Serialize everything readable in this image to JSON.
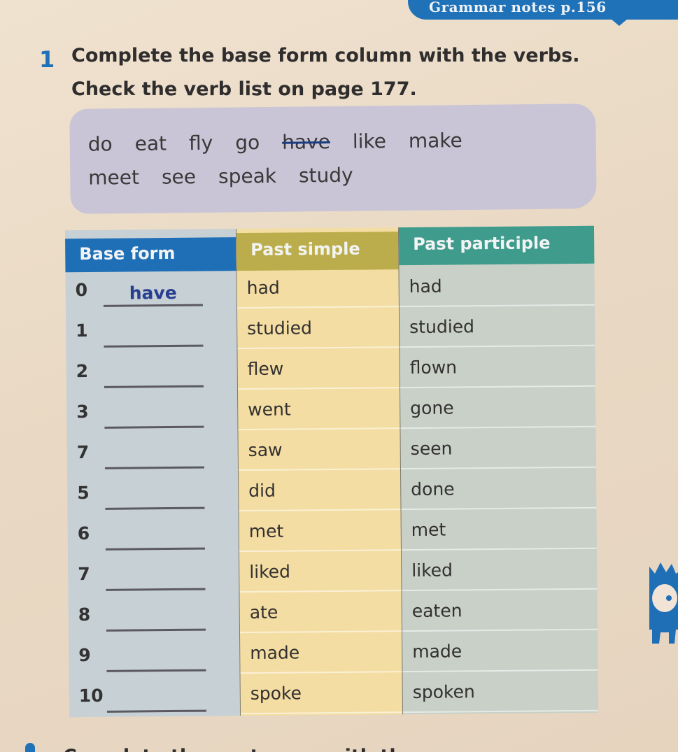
{
  "grammar_tab": {
    "label": "Grammar notes p.156"
  },
  "exercise": {
    "number": "1",
    "instruction_line1": "Complete the base form column with the verbs.",
    "instruction_line2": "Check the verb list on page 177."
  },
  "word_box": {
    "line1": [
      {
        "text": "do",
        "crossed": false
      },
      {
        "text": "eat",
        "crossed": false
      },
      {
        "text": "fly",
        "crossed": false
      },
      {
        "text": "go",
        "crossed": false
      },
      {
        "text": "have",
        "crossed": true
      },
      {
        "text": "like",
        "crossed": false
      },
      {
        "text": "make",
        "crossed": false
      }
    ],
    "line2": [
      {
        "text": "meet",
        "crossed": false
      },
      {
        "text": "see",
        "crossed": false
      },
      {
        "text": "speak",
        "crossed": false
      },
      {
        "text": "study",
        "crossed": false
      }
    ]
  },
  "table": {
    "headers": {
      "base": "Base form",
      "past": "Past simple",
      "participle": "Past participle"
    },
    "colors": {
      "base_header": "#1f6fb7",
      "past_header": "#bcad4c",
      "participle_header": "#3f9b8c"
    },
    "rows": [
      {
        "num": "0",
        "base": "have",
        "past": "had",
        "participle": "had"
      },
      {
        "num": "1",
        "base": "",
        "past": "studied",
        "participle": "studied"
      },
      {
        "num": "2",
        "base": "",
        "past": "flew",
        "participle": "flown"
      },
      {
        "num": "3",
        "base": "",
        "past": "went",
        "participle": "gone"
      },
      {
        "num": "7",
        "base": "",
        "past": "saw",
        "participle": "seen"
      },
      {
        "num": "5",
        "base": "",
        "past": "did",
        "participle": "done"
      },
      {
        "num": "6",
        "base": "",
        "past": "met",
        "participle": "met"
      },
      {
        "num": "7",
        "base": "",
        "past": "liked",
        "participle": "liked"
      },
      {
        "num": "8",
        "base": "",
        "past": "ate",
        "participle": "eaten"
      },
      {
        "num": "9",
        "base": "",
        "past": "made",
        "participle": "made"
      },
      {
        "num": "10",
        "base": "",
        "past": "spoke",
        "participle": "spoken"
      }
    ]
  },
  "next_exercise": {
    "text": "Complete the sentences with the verbs ..."
  },
  "icons": {
    "mascot": "blue-monster-mascot-icon"
  }
}
